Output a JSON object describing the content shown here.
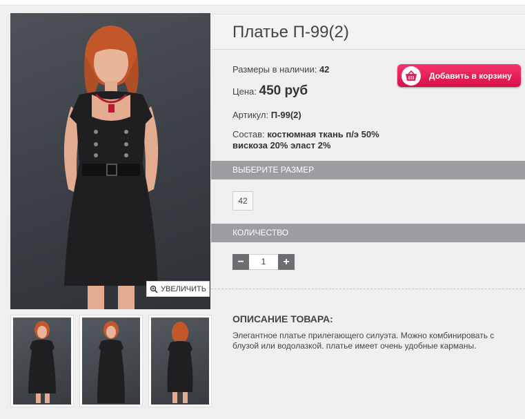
{
  "product": {
    "title": "Платье П-99(2)",
    "sizes_label": "Размеры в наличии:",
    "sizes_value": "42",
    "price_label": "Цена:",
    "price_value": "450 руб",
    "article_label": "Артикул:",
    "article_value": "П-99(2)",
    "composition_label": "Состав:",
    "composition_value_line1": "костюмная ткань п/э 50%",
    "composition_value_line2": "вискоза 20% эласт 2%"
  },
  "cart_button": {
    "label": "Добавить в корзину",
    "icon": "basket-icon",
    "color": "#e5215a"
  },
  "gallery": {
    "zoom_label": "УВЕЛИЧИТЬ",
    "zoom_icon": "magnifier-icon"
  },
  "size_section": {
    "title": "ВЫБЕРИТЕ РАЗМЕР",
    "options": [
      "42"
    ]
  },
  "quantity_section": {
    "title": "КОЛИЧЕСТВО",
    "minus": "−",
    "plus": "+",
    "value": "1"
  },
  "description": {
    "title": "ОПИСАНИЕ ТОВАРА:",
    "text": "Элегантное платье прилегающего силуэта. Можно комбинировать с блузой или водолазкой. платье имеет очень удобные карманы."
  },
  "colors": {
    "section_bar": "#9b9da0",
    "accent": "#e5215a"
  }
}
